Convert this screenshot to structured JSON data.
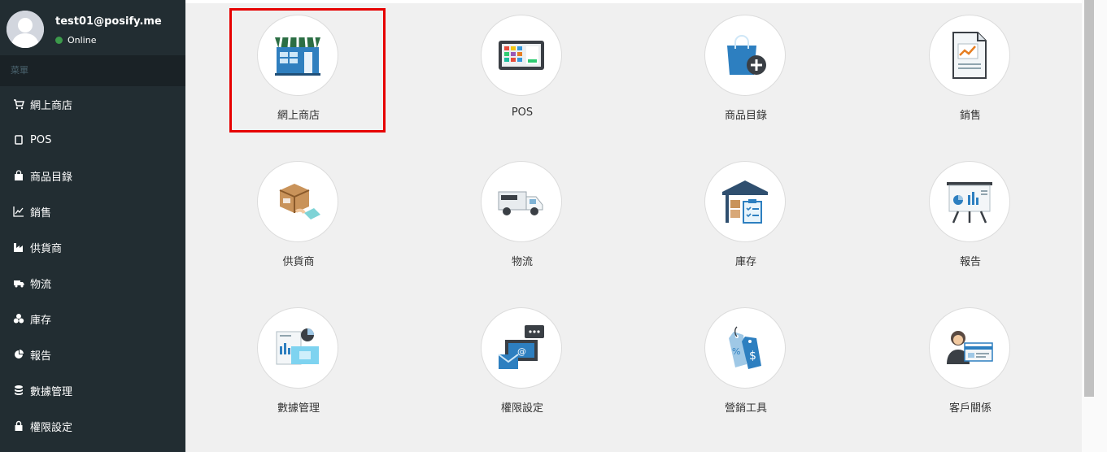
{
  "user": {
    "email": "test01@posify.me",
    "status": "Online"
  },
  "sidebar": {
    "header": "菜單",
    "items": [
      {
        "label": "網上商店",
        "icon": "cart-icon"
      },
      {
        "label": "POS",
        "icon": "tablet-icon"
      },
      {
        "label": "商品目錄",
        "icon": "shopping-bag-icon"
      },
      {
        "label": "銷售",
        "icon": "line-chart-icon"
      },
      {
        "label": "供貨商",
        "icon": "industry-icon"
      },
      {
        "label": "物流",
        "icon": "truck-icon"
      },
      {
        "label": "庫存",
        "icon": "cubes-icon"
      },
      {
        "label": "報告",
        "icon": "pie-chart-icon"
      },
      {
        "label": "數據管理",
        "icon": "database-icon"
      },
      {
        "label": "權限設定",
        "icon": "lock-icon"
      }
    ]
  },
  "tiles": [
    {
      "label": "網上商店",
      "icon": "storefront-icon"
    },
    {
      "label": "POS",
      "icon": "pos-terminal-icon"
    },
    {
      "label": "商品目錄",
      "icon": "shopping-bag-add-icon"
    },
    {
      "label": "銷售",
      "icon": "sales-report-icon"
    },
    {
      "label": "供貨商",
      "icon": "package-delivery-icon"
    },
    {
      "label": "物流",
      "icon": "delivery-truck-icon"
    },
    {
      "label": "庫存",
      "icon": "warehouse-icon"
    },
    {
      "label": "報告",
      "icon": "presentation-board-icon"
    },
    {
      "label": "數據管理",
      "icon": "data-dashboard-icon"
    },
    {
      "label": "權限設定",
      "icon": "email-chat-icon"
    },
    {
      "label": "營銷工具",
      "icon": "price-tags-icon"
    },
    {
      "label": "客戶關係",
      "icon": "customer-card-icon"
    }
  ],
  "colors": {
    "sidebar_bg": "#222d32",
    "highlight": "#e60000",
    "online": "#3c9a4b"
  }
}
